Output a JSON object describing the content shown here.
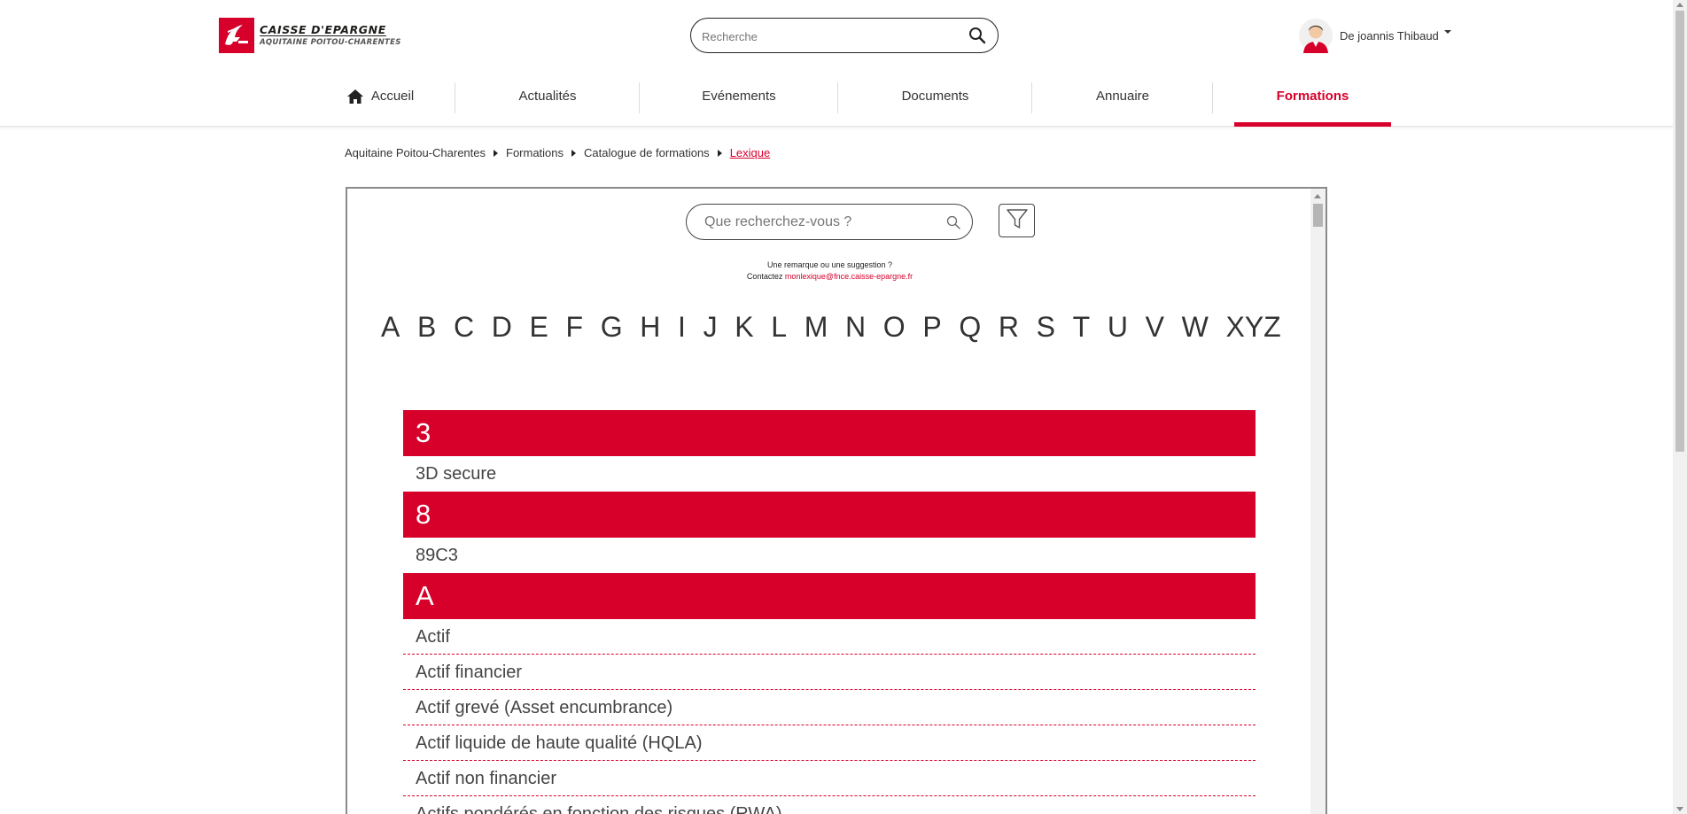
{
  "brand": {
    "line1": "CAISSE D'EPARGNE",
    "line2": "AQUITAINE POITOU-CHARENTES",
    "accent_color": "#d6002b"
  },
  "header": {
    "search_placeholder": "Recherche",
    "user_name": "De joannis Thibaud"
  },
  "nav": {
    "items": [
      {
        "label": "Accueil",
        "icon": "home-icon"
      },
      {
        "label": "Actualités"
      },
      {
        "label": "Evénements"
      },
      {
        "label": "Documents"
      },
      {
        "label": "Annuaire"
      },
      {
        "label": "Formations",
        "active": true
      }
    ]
  },
  "breadcrumb": {
    "items": [
      "Aquitaine Poitou-Charentes",
      "Formations",
      "Catalogue de formations"
    ],
    "current": "Lexique"
  },
  "lexique": {
    "search_placeholder": "Que recherchez-vous ?",
    "note_line1": "Une remarque ou une suggestion ?",
    "note_prefix": "Contactez",
    "note_email": "monlexique@fnce.caisse-epargne.fr",
    "alphabet": [
      "A",
      "B",
      "C",
      "D",
      "E",
      "F",
      "G",
      "H",
      "I",
      "J",
      "K",
      "L",
      "M",
      "N",
      "O",
      "P",
      "Q",
      "R",
      "S",
      "T",
      "U",
      "V",
      "W",
      "XYZ"
    ],
    "sections": [
      {
        "letter": "3",
        "terms": [
          "3D secure"
        ]
      },
      {
        "letter": "8",
        "terms": [
          "89C3"
        ]
      },
      {
        "letter": "A",
        "terms": [
          "Actif",
          "Actif financier",
          "Actif grevé (Asset encumbrance)",
          "Actif liquide de haute qualité (HQLA)",
          "Actif non financier",
          "Actifs pondérés en fonction des risques (RWA)"
        ]
      }
    ]
  }
}
